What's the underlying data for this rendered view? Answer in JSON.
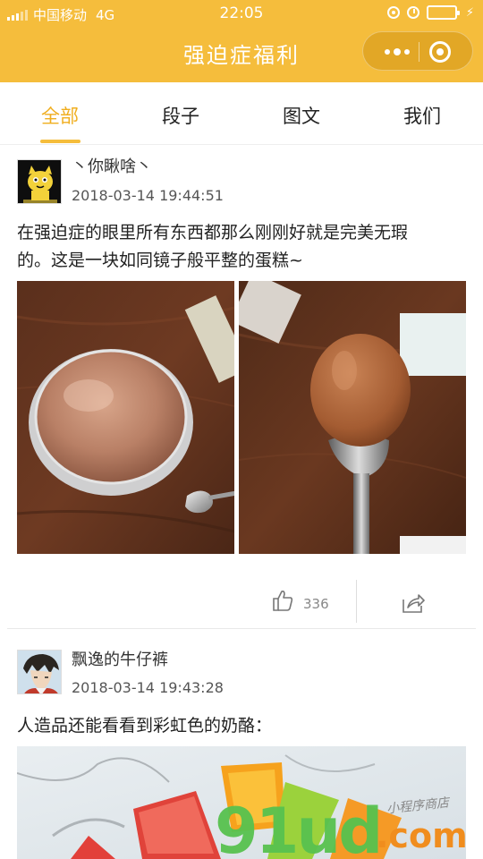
{
  "status_bar": {
    "carrier": "中国移动",
    "network": "4G",
    "time": "22:05"
  },
  "header": {
    "title": "强迫症福利"
  },
  "tabs": [
    {
      "label": "全部",
      "active": true
    },
    {
      "label": "段子",
      "active": false
    },
    {
      "label": "图文",
      "active": false
    },
    {
      "label": "我们",
      "active": false
    }
  ],
  "posts": [
    {
      "username": "丶你瞅啥丶",
      "time": "2018-03-14 19:44:51",
      "content_line1": "在强迫症的眼里所有东西都那么刚刚好就是完美无瑕",
      "content_line2": "的。这是一块如同镜子般平整的蛋糕~",
      "likes": "336"
    },
    {
      "username": "飘逸的牛仔裤",
      "time": "2018-03-14 19:43:28",
      "content": "人造品还能看看到彩虹色的奶酪："
    }
  ],
  "watermark": {
    "main": "91ud",
    "domain": ".com",
    "sub": "小程序商店"
  },
  "colors": {
    "accent": "#f5bd3c",
    "active_tab": "#f0ae1f"
  }
}
